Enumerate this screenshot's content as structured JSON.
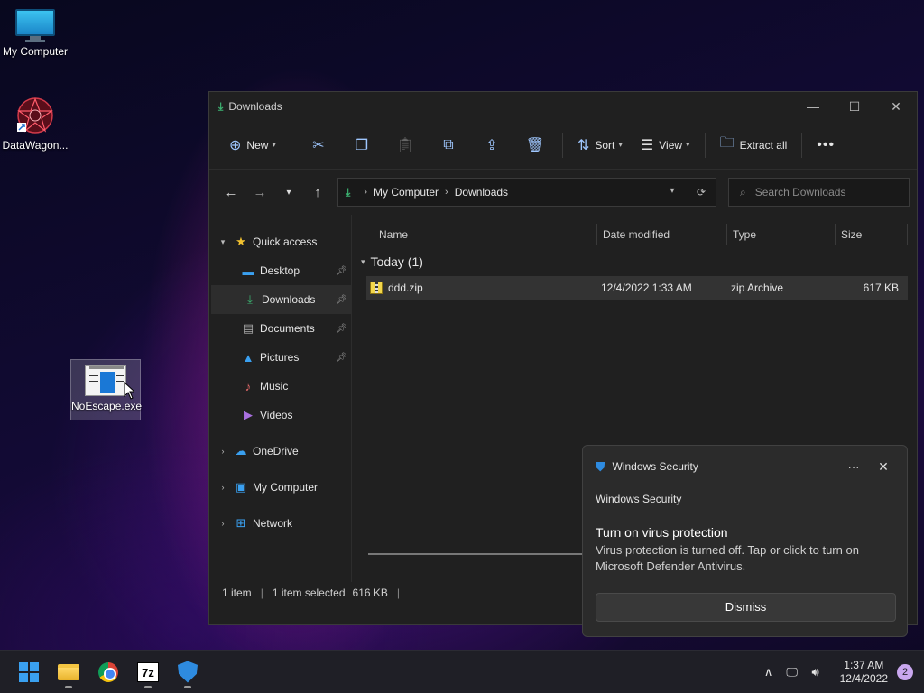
{
  "desktop": {
    "icons": [
      {
        "label": "My Computer"
      },
      {
        "label": "DataWagon..."
      },
      {
        "label": "NoEscape.exe"
      }
    ]
  },
  "explorer": {
    "title": "Downloads",
    "toolbar": {
      "new_label": "New",
      "sort_label": "Sort",
      "view_label": "View",
      "extract_label": "Extract all"
    },
    "breadcrumb": [
      "My Computer",
      "Downloads"
    ],
    "search_placeholder": "Search Downloads",
    "nav": {
      "quick_access": "Quick access",
      "items": [
        "Desktop",
        "Downloads",
        "Documents",
        "Pictures",
        "Music",
        "Videos"
      ],
      "onedrive": "OneDrive",
      "my_computer": "My Computer",
      "network": "Network"
    },
    "columns": [
      "Name",
      "Date modified",
      "Type",
      "Size"
    ],
    "group": "Today (1)",
    "files": [
      {
        "name": "ddd.zip",
        "date": "12/4/2022 1:33 AM",
        "type": "zip Archive",
        "size": "617 KB"
      }
    ],
    "status": {
      "count": "1 item",
      "selected": "1 item selected",
      "selected_size": "616 KB"
    }
  },
  "toast": {
    "app": "Windows Security",
    "source": "Windows Security",
    "title": "Turn on virus protection",
    "text": "Virus protection is turned off. Tap or click to turn on Microsoft Defender Antivirus.",
    "dismiss": "Dismiss"
  },
  "taskbar": {
    "time": "1:37 AM",
    "date": "12/4/2022",
    "notifications": "2",
    "sevenzip_label": "7z"
  },
  "colors": {
    "accent": "#3aa0f0",
    "download_green": "#3cb371",
    "defender_blue": "#2e8be0"
  }
}
